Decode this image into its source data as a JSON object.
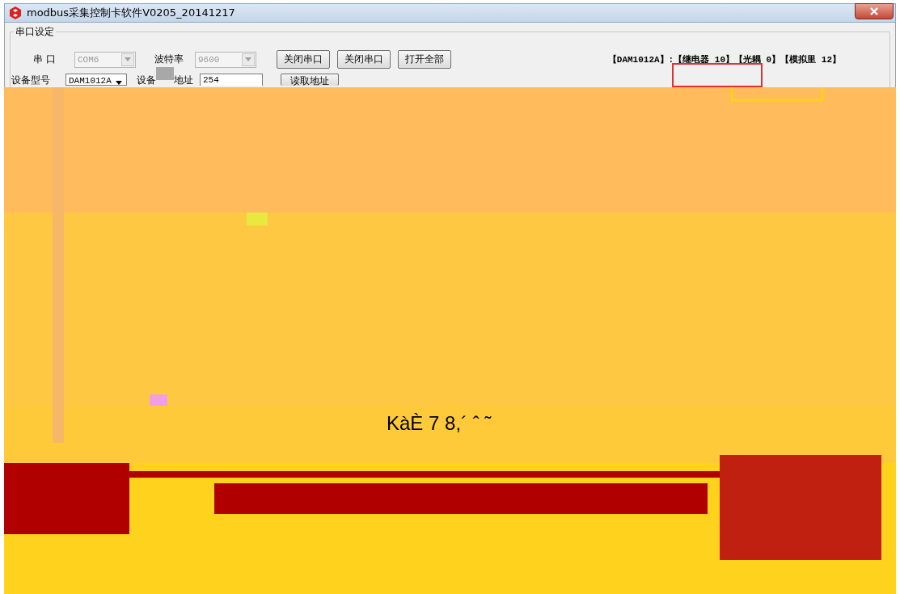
{
  "window": {
    "title": "modbus采集控制卡软件V0205_20141217"
  },
  "group": {
    "title": "串口设定"
  },
  "port": {
    "label": "串 口",
    "value": "COM6",
    "disabled": true
  },
  "baud": {
    "label": "波特率",
    "value": "9600",
    "disabled": true
  },
  "buttons": [
    "关闭串口",
    "关闭串口",
    "打开全部"
  ],
  "device_info": "【DAM1012A】:【继电器  10】【光耦 0】【模拟里 12】",
  "model": {
    "label": "设备型号",
    "value": "DAM1012A",
    "disabled": false
  },
  "address": {
    "label_1": "设备",
    "label_2": "地址",
    "value": "254"
  },
  "read_button": "读取地址",
  "corrupt_text": "KàÈ 7 8,´ ˆ ˜"
}
